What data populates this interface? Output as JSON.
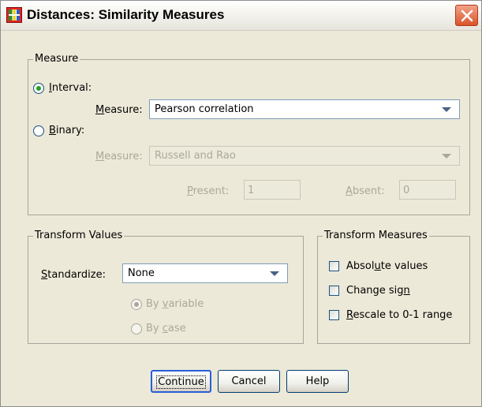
{
  "window": {
    "title": "Distances: Similarity Measures"
  },
  "measure_group": {
    "label": "Measure",
    "interval": {
      "label": "Interval:",
      "checked": true,
      "measure_label": "Measure:",
      "measure_value": "Pearson correlation"
    },
    "binary": {
      "label": "Binary:",
      "checked": false,
      "measure_label": "Measure:",
      "measure_value": "Russell and Rao",
      "present_label": "Present:",
      "present_value": "1",
      "absent_label": "Absent:",
      "absent_value": "0"
    }
  },
  "transform_values": {
    "label": "Transform Values",
    "standardize_label": "Standardize:",
    "standardize_value": "None",
    "by_variable_label": "By variable",
    "by_case_label": "By case"
  },
  "transform_measures": {
    "label": "Transform Measures",
    "absolute_values_label": "Absolute values",
    "change_sign_label": "Change sign",
    "rescale_label": "Rescale to 0-1 range"
  },
  "buttons": {
    "continue": "Continue",
    "cancel": "Cancel",
    "help": "Help"
  }
}
